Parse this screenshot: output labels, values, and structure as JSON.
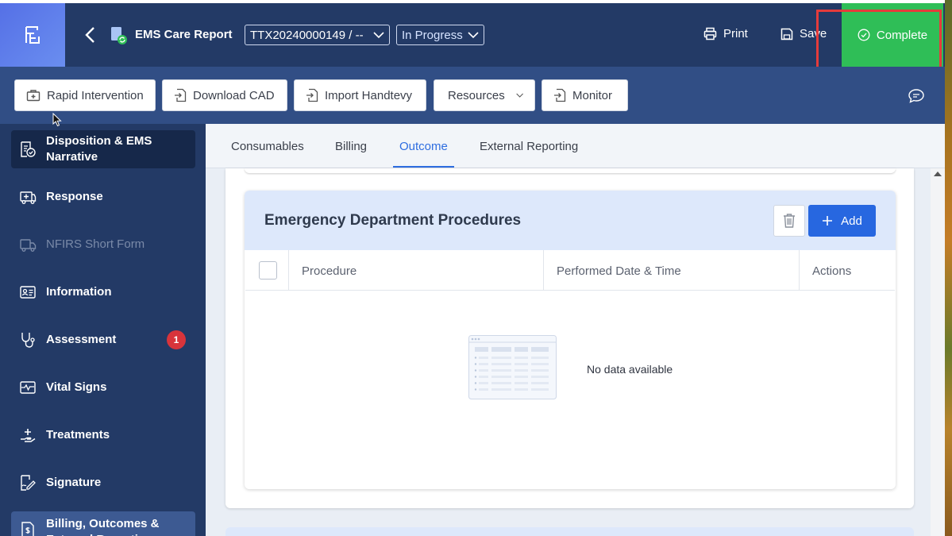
{
  "header": {
    "app_title": "EMS Care Report",
    "report_id": "TTX20240000149 / --",
    "status": "In Progress",
    "print_label": "Print",
    "save_label": "Save",
    "complete_label": "Complete"
  },
  "toolbar": {
    "buttons": [
      "Rapid Intervention",
      "Download CAD",
      "Import Handtevy",
      "Resources",
      "Monitor"
    ]
  },
  "sidebar": {
    "items": [
      {
        "label": "Disposition & EMS Narrative",
        "icon": "disposition-icon"
      },
      {
        "label": "Response",
        "icon": "response-icon"
      },
      {
        "label": "NFIRS Short Form",
        "icon": "truck-icon"
      },
      {
        "label": "Information",
        "icon": "id-card-icon"
      },
      {
        "label": "Assessment",
        "icon": "stethoscope-icon",
        "badge": "1"
      },
      {
        "label": "Vital Signs",
        "icon": "vitals-icon"
      },
      {
        "label": "Treatments",
        "icon": "treatment-icon"
      },
      {
        "label": "Signature",
        "icon": "signature-icon"
      },
      {
        "label": "Billing, Outcomes & External Reporting",
        "icon": "billing-icon"
      }
    ]
  },
  "tabs": [
    "Consumables",
    "Billing",
    "Outcome",
    "External Reporting"
  ],
  "active_tab": "Outcome",
  "card": {
    "title": "Emergency Department Procedures",
    "add_label": "Add",
    "columns": [
      "Procedure",
      "Performed Date & Time",
      "Actions"
    ],
    "empty_text": "No data available"
  },
  "colors": {
    "header_bg": "#233a66",
    "toolbar_bg": "#314e85",
    "complete_green": "#2fbe57",
    "accent_blue": "#2767e0",
    "badge_red": "#d8343b",
    "highlight_red": "#e53b3b"
  }
}
